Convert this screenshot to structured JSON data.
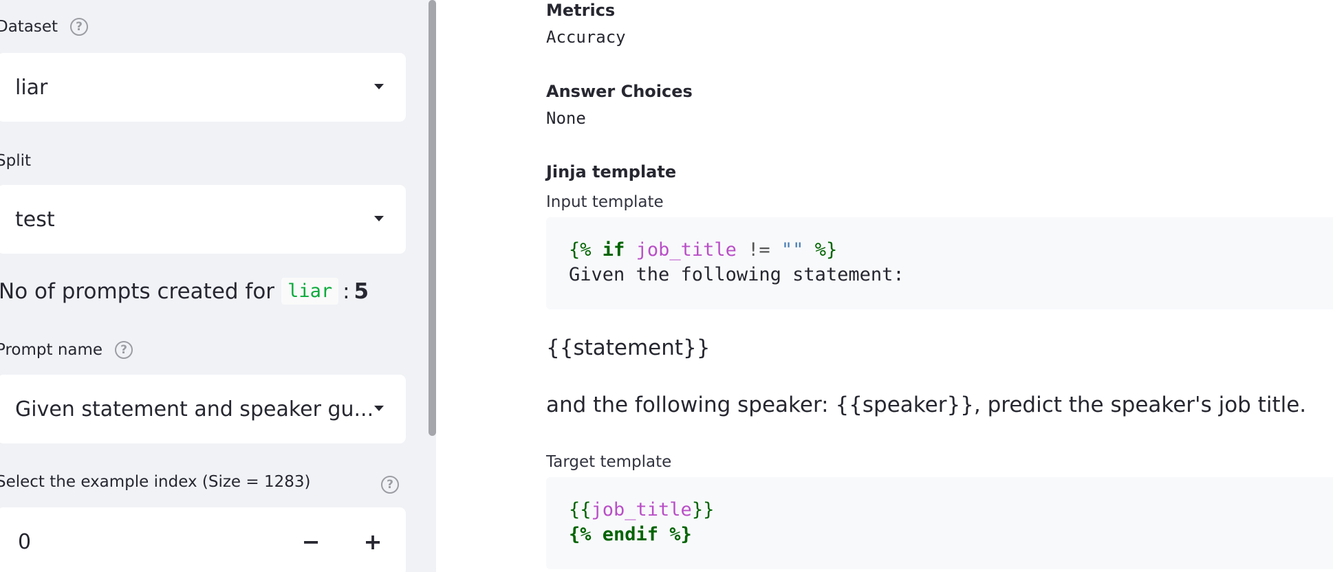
{
  "sidebar": {
    "dataset": {
      "label": "Dataset",
      "value": "liar"
    },
    "split": {
      "label": "Split",
      "value": "test"
    },
    "prompt_count": {
      "prefix": "No of prompts created for",
      "dataset_code": "liar",
      "separator": ":",
      "count": "5"
    },
    "prompt_name": {
      "label": "Prompt name",
      "value": "Given statement and speaker gu..."
    },
    "example_index": {
      "label": "Select the example index (Size = 1283)",
      "value": "0",
      "minus": "−",
      "plus": "+"
    },
    "help_glyph": "?"
  },
  "main": {
    "metrics": {
      "heading": "Metrics",
      "value": "Accuracy"
    },
    "answer_choices": {
      "heading": "Answer Choices",
      "value": "None"
    },
    "jinja": {
      "heading": "Jinja template",
      "input_label": "Input template",
      "input_code": {
        "l1_open": "{%",
        "l1_if": "if",
        "l1_var": "job_title",
        "l1_op": "!=",
        "l1_str": "\"\"",
        "l1_close": "%}",
        "l2": "Given the following statement:"
      },
      "rendered_statement": "{{statement}}",
      "rendered_speaker": "and the following speaker: {{speaker}}, predict the speaker's job title.",
      "target_label": "Target template",
      "target_code": {
        "l1_open": "{{",
        "l1_var": "job_title",
        "l1_close": "}}",
        "l2": "{% endif %}"
      }
    }
  },
  "colors": {
    "sidebar_bg": "#f0f2f6",
    "code_green": "#09ab3b",
    "jinja_var": "#b94fc7",
    "jinja_keyword": "#006400"
  }
}
